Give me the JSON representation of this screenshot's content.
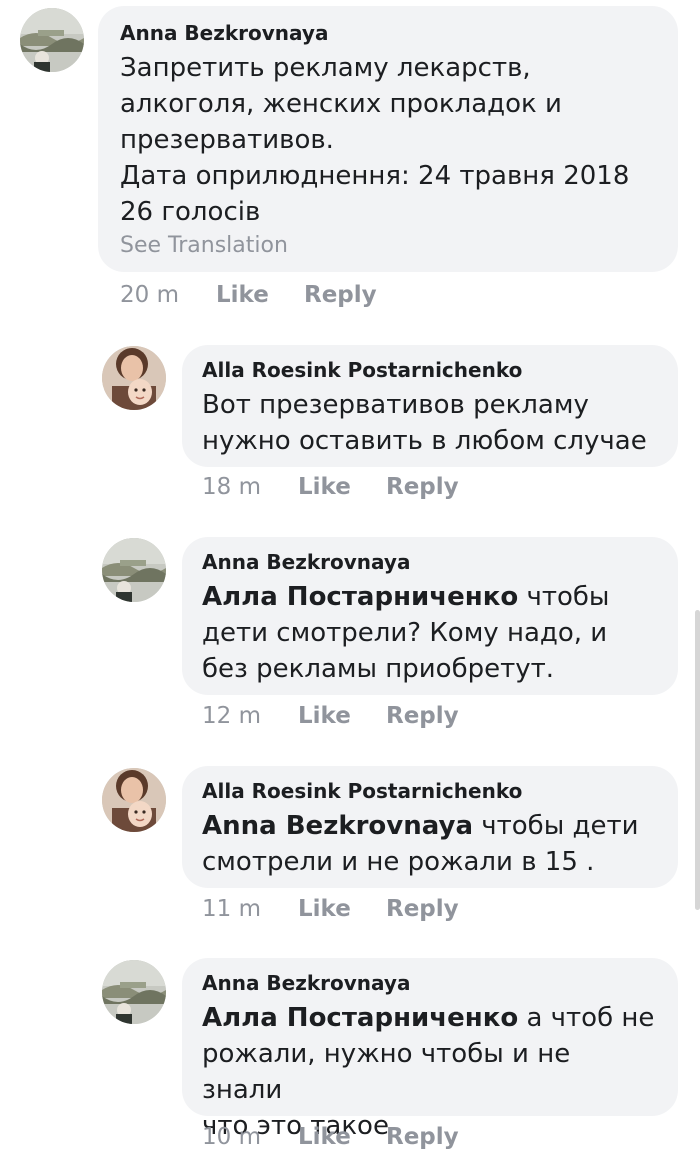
{
  "comments": [
    {
      "author": "Anna Bezkrovnaya",
      "avatar": "reflection-photo",
      "mention": "",
      "text": "Запретить рекламу лекарств,\nалкоголя, женских прокладок и\nпрезервативов.\nДата оприлюднення: 24 травня 2018\n26 голосів",
      "see_translation": "See Translation",
      "time": "20 m",
      "like": "Like",
      "reply": "Reply"
    },
    {
      "author": "Alla Roesink Postarnichenko",
      "avatar": "mother-child-photo",
      "mention": "",
      "text": "Вот презервативов рекламу\nнужно оставить в любом случае",
      "time": "18 m",
      "like": "Like",
      "reply": "Reply"
    },
    {
      "author": "Anna Bezkrovnaya",
      "avatar": "reflection-photo",
      "mention": "Алла Постарниченко",
      "text": " чтобы\nдети смотрели? Кому надо, и\nбез рекламы приобретут.",
      "time": "12 m",
      "like": "Like",
      "reply": "Reply"
    },
    {
      "author": "Alla Roesink Postarnichenko",
      "avatar": "mother-child-photo",
      "mention": "Anna Bezkrovnaya",
      "text": " чтобы дети\nсмотрели и не рожали в 15 .",
      "time": "11 m",
      "like": "Like",
      "reply": "Reply"
    },
    {
      "author": "Anna Bezkrovnaya",
      "avatar": "reflection-photo",
      "mention": "Алла Постарниченко",
      "text": " а чтоб не\nрожали, нужно чтобы и не знали\nчто это такое",
      "time": "10 m",
      "like": "Like",
      "reply": "Reply"
    }
  ]
}
